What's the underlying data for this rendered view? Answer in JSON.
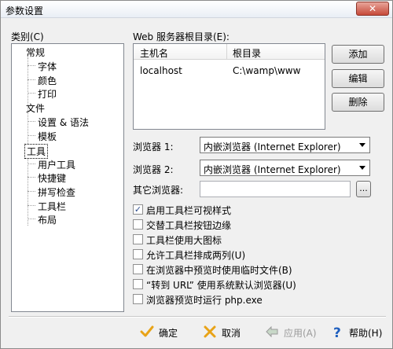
{
  "window": {
    "title": "参数设置",
    "close_glyph": "✕"
  },
  "category": {
    "label": "类别(C)",
    "items": [
      "常规",
      "字体",
      "颜色",
      "打印",
      "文件",
      "设置 & 语法",
      "模板",
      "工具",
      "用户工具",
      "快捷键",
      "拼写检查",
      "工具栏",
      "布局"
    ]
  },
  "webroot": {
    "label": "Web 服务器根目录(E):",
    "columns": [
      "主机名",
      "根目录"
    ],
    "rows": [
      {
        "host": "localhost",
        "root": "C:\\wamp\\www"
      }
    ]
  },
  "buttons": {
    "add": "添加",
    "edit": "编辑",
    "delete": "删除",
    "browse": "..."
  },
  "browsers": {
    "browser1_label": "浏览器 1:",
    "browser1_value": "内嵌浏览器 (Internet Explorer)",
    "browser2_label": "浏览器 2:",
    "browser2_value": "内嵌浏览器 (Internet Explorer)",
    "other_label": "其它浏览器:",
    "other_value": ""
  },
  "options": [
    {
      "label": "启用工具栏可视样式",
      "checked": true
    },
    {
      "label": "交替工具栏按钮边缘",
      "checked": false
    },
    {
      "label": "工具栏使用大图标",
      "checked": false
    },
    {
      "label": "允许工具栏排成两列(U)",
      "checked": false
    },
    {
      "label": "在浏览器中预览时使用临时文件(B)",
      "checked": false
    },
    {
      "label": "“转到 URL” 使用系统默认浏览器(U)",
      "checked": false
    },
    {
      "label": "浏览器预览时运行 php.exe",
      "checked": false
    }
  ],
  "footer": {
    "ok": "确定",
    "cancel": "取消",
    "apply": "应用(A)",
    "help": "帮助(H)",
    "colors": {
      "ok": "#e8a317",
      "cancel": "#e8a317",
      "apply_disabled": "#9a9a9a",
      "help": "#1f5fbf"
    }
  },
  "icons": [
    "check-icon",
    "x-icon",
    "arrow-left-icon",
    "question-icon",
    "chevron-down-icon",
    "checkmark-icon"
  ]
}
